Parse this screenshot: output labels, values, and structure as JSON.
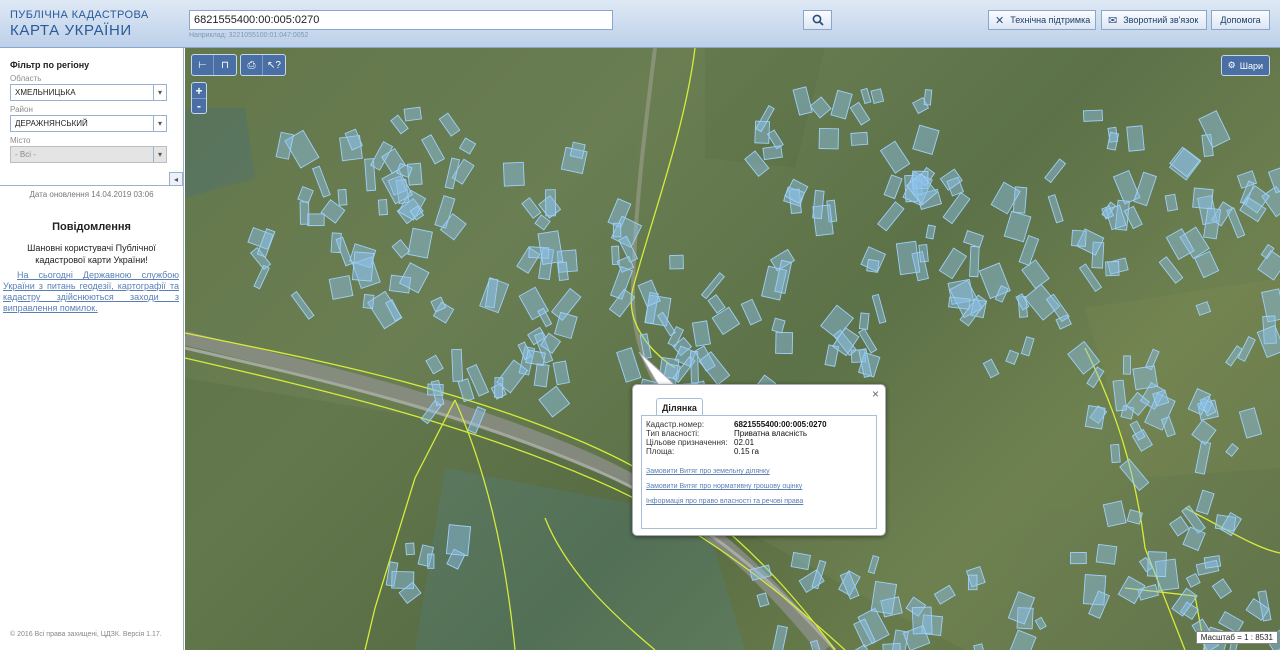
{
  "header": {
    "logo_line1": "ПУБЛІЧНА КАДАСТРОВА",
    "logo_line2": "КАРТА УКРАЇНИ",
    "search_value": "6821555400:00:005:0270",
    "search_hint": "Наприклад: 3221055100:01:047:0052",
    "support_label": "Технічна підтримка",
    "feedback_label": "Зворотний зв'язок",
    "help_label": "Допомога"
  },
  "sidebar": {
    "filter_title": "Фільтр по регіону",
    "oblast_label": "Область",
    "oblast_value": "ХМЕЛЬНИЦЬКА",
    "rayon_label": "Район",
    "rayon_value": "ДЕРАЖНЯНСЬКИЙ",
    "misto_label": "Місто",
    "misto_value": "- Всі -",
    "update_date": "Дата оновлення  14.04.2019 03:06",
    "notice_title": "Повідомлення",
    "notice_text": "Шановні користувачі Публічної кадастрової карти України!",
    "notice_link": "На сьогодні Державною службою України з питань геодезії, картографії та кадастру здійснюються заходи з виправлення помилок.",
    "copyright": "© 2016 Всі права захищені, ЦДЗК. Версія 1.17."
  },
  "map": {
    "layers_label": "Шари",
    "scale_label": "Масштаб = 1 : 8531",
    "parcel_color": "#8ec3ee",
    "boundary_color": "#d6ec3a"
  },
  "popup": {
    "tab_label": "Ділянка",
    "rows": [
      {
        "key": "Кадастр.номер:",
        "value": "6821555400:00:005:0270"
      },
      {
        "key": "Тип власності:",
        "value": "Приватна власність"
      },
      {
        "key": "Цільове призначення:",
        "value": "02.01"
      },
      {
        "key": "Площа:",
        "value": "0.15 га"
      }
    ],
    "links": [
      "Замовити Витяг про земельну ділянку",
      "Замовити Витяг про нормативну грошову оцінку",
      "Інформація про право власності та речові права"
    ]
  }
}
